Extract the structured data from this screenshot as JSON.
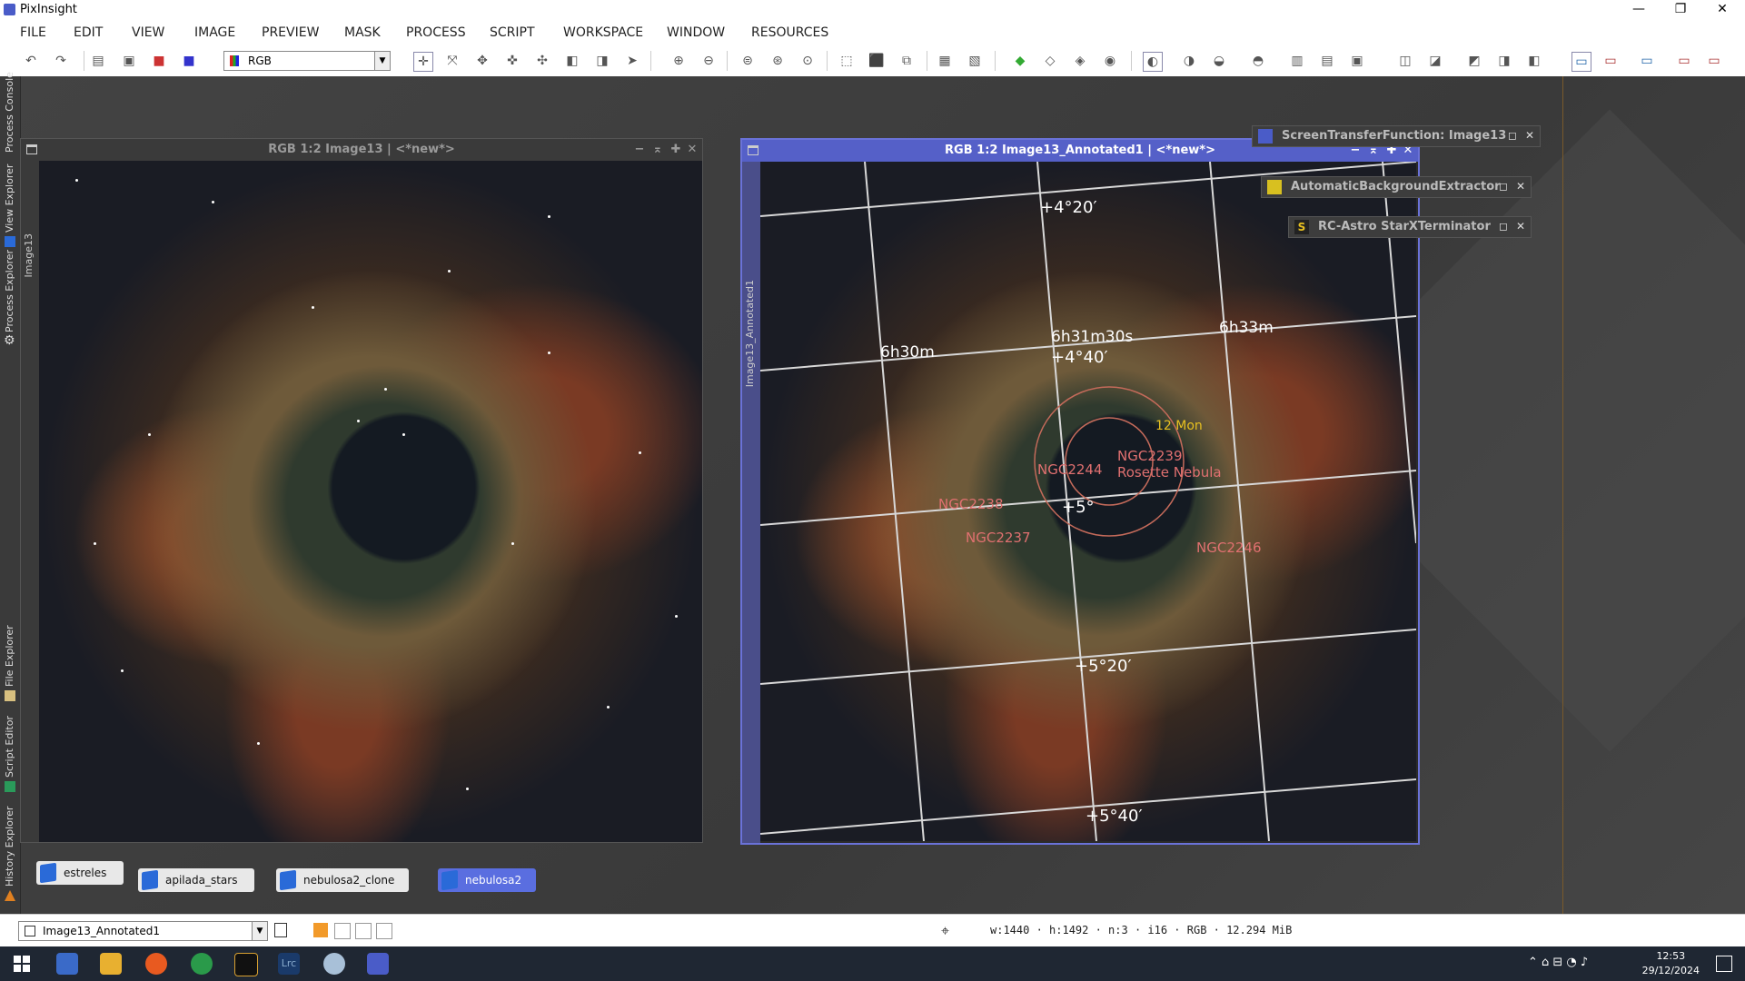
{
  "window": {
    "title": "PixInsight",
    "minimize": "—",
    "restore": "❐",
    "close": "✕"
  },
  "menu": [
    "FILE",
    "EDIT",
    "VIEW",
    "IMAGE",
    "PREVIEW",
    "MASK",
    "PROCESS",
    "SCRIPT",
    "WORKSPACE",
    "WINDOW",
    "RESOURCES"
  ],
  "toolbar": {
    "rgb_select": "RGB"
  },
  "sidebar_tabs": [
    "Process Console",
    "View Explorer",
    "Process Explorer",
    "File Explorer",
    "Script Editor",
    "History Explorer"
  ],
  "image_windows": [
    {
      "title": "RGB 1:2 Image13 | <*new*>",
      "side_label": "Image13"
    },
    {
      "title": "RGB 1:2 Image13_Annotated1 | <*new*>",
      "side_label": "Image13_Annotated1"
    }
  ],
  "annotations": {
    "dec_labels": [
      "+4°20′",
      "+4°40′",
      "+5°",
      "+5°20′",
      "+5°40′"
    ],
    "ra_labels": [
      "6h30m",
      "6h31m30s",
      "6h33m"
    ],
    "objects": [
      "12 Mon",
      "NGC2244",
      "NGC2239",
      "Rosette Nebula",
      "NGC2238",
      "NGC2237",
      "NGC2246"
    ]
  },
  "float_panels": [
    "ScreenTransferFunction: Image13",
    "AutomaticBackgroundExtractor",
    "RC-Astro StarXTerminator"
  ],
  "view_icons": [
    "estreles",
    "apilada_stars",
    "nebulosa2_clone",
    "nebulosa2"
  ],
  "statusbar": {
    "view": "Image13_Annotated1",
    "info": "w:1440 · h:1492 · n:3 · i16 · RGB · 12.294 MiB"
  },
  "taskbar": {
    "time": "12:53",
    "date": "29/12/2024"
  },
  "colors": {
    "accent": "#4a5cc8",
    "annotation_red": "#e07070",
    "annotation_yellow": "#e8c020",
    "grid": "#d8d8d8"
  }
}
